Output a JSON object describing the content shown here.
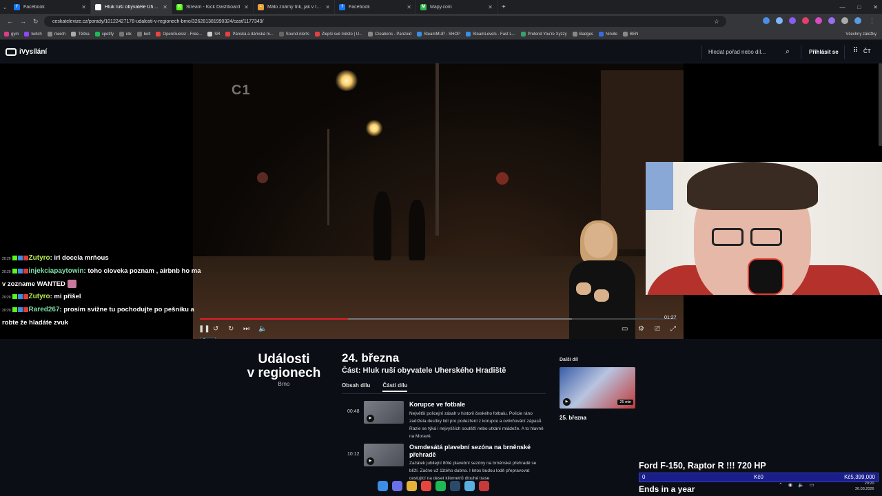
{
  "browser": {
    "tabs": [
      {
        "title": "Facebook",
        "icon_color": "#1877f2",
        "icon_letter": "f"
      },
      {
        "title": "Hluk ruší obyvatele Uhersk",
        "icon_color": "#ffffff",
        "icon_letter": "",
        "active": true
      },
      {
        "title": "Stream - Kick Dashboard",
        "icon_color": "#53fc18",
        "icon_letter": "K"
      },
      {
        "title": "Málo známý trik, jak v tarifech",
        "icon_color": "#e8a03a",
        "icon_letter": "•"
      },
      {
        "title": "Facebook",
        "icon_color": "#1877f2",
        "icon_letter": "f"
      },
      {
        "title": "Mapy.com",
        "icon_color": "#2fb64a",
        "icon_letter": "M"
      }
    ],
    "url": "ceskatelevize.cz/porady/10122427178-udalosti-v-regionech-brno/326281381990324/cast/1177349/",
    "bookmarks": [
      "gym",
      "twitch",
      "merch",
      "Těčka",
      "spotify",
      "idk",
      "bolt",
      "OpenGuessr - Free...",
      "SR",
      "Pánská a dámská m...",
      "Sound Alerts",
      "Zlepši své město | U...",
      "Creabons - Panzoid",
      "SteamMUP - SHOP",
      "SteamLevels - Fast L...",
      "Pretend You're Xyzzy",
      "Badges",
      "Nirvite",
      "BEN"
    ],
    "bookmarks_all": "Všechny záložky"
  },
  "site": {
    "logo": "iVysílání",
    "search_placeholder": "Hledat pořad nebo díl...",
    "login": "Přihlásit se",
    "ct": "ČT"
  },
  "video": {
    "channel_logo": "1",
    "time": "01:27",
    "progress": 0.31,
    "buffered_to": 0.78,
    "tooltip": "Pauza"
  },
  "chat": [
    {
      "time": "20:20",
      "user": "Zutyro",
      "user_color": "#b8f050",
      "msg": ": irl docela mrňous"
    },
    {
      "time": "20:20",
      "user": "injekciapaytowin",
      "user_color": "#7ee0a8",
      "msg": ": toho cloveka poznam , airbnb ho ma v zozname WANTED"
    },
    {
      "time": "20:20",
      "user": "Zutyro",
      "user_color": "#b8f050",
      "msg": ": mi přišel"
    },
    {
      "time": "20:20",
      "user": "Rared267",
      "user_color": "#7ee0a8",
      "msg": ": prosím svižne tu pochodujte po pešniku a robte že hladáte zvuk"
    }
  ],
  "episode": {
    "show_title_1": "Události",
    "show_title_2": "v regionech",
    "show_sub": "Brno",
    "date": "24. března",
    "part": "Část: Hluk ruší obyvatele Uherského Hradiště",
    "tabs": [
      "Obsah dílu",
      "Části dílu"
    ],
    "segments": [
      {
        "time": "00:48",
        "title": "Korupce ve fotbale",
        "desc": "Největší policejní zásah v historii českého fotbalu. Policie ráno zadržela desítky lidí pro podezření z korupce a ovlivňování zápasů. Razie se týká i nejvyšších soutěží nebo utkání mládeže. A to hlavně na Moravě."
      },
      {
        "time": "10:12",
        "title": "Osmdesátá plavební sezóna na brněnské přehradě",
        "desc": "Začátek jubilejní 80té plavební sezóny na brněnské přehradě se blíží. Začne už 11tého dubna. I letos budou lodě přepravovat cestující na deset kilometrů dlouhé trase"
      }
    ],
    "next_label": "Další díl",
    "next_duration": "25 min",
    "next_date": "25. března"
  },
  "promo": {
    "title": "Ford F-150, Raptor R !!! 720 HP",
    "start": "0",
    "current": "Kč0",
    "goal": "Kč5,399,000",
    "progress": 0.0,
    "ends": "Ends in a year"
  },
  "clock": {
    "time": "20:20",
    "date": "26.03.2026"
  }
}
